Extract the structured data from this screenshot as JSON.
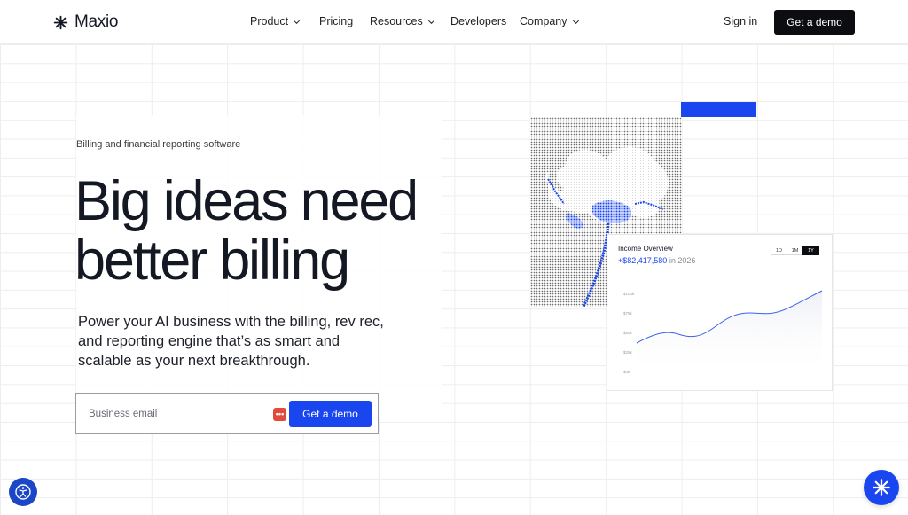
{
  "nav": {
    "logo_text": "Maxio",
    "links": [
      {
        "label": "Product",
        "has_dropdown": true
      },
      {
        "label": "Pricing",
        "has_dropdown": false
      },
      {
        "label": "Resources",
        "has_dropdown": true
      },
      {
        "label": "Developers",
        "has_dropdown": false
      },
      {
        "label": "Company",
        "has_dropdown": true
      }
    ],
    "sign_in": "Sign in",
    "cta": "Get a demo"
  },
  "hero": {
    "eyebrow": "Billing and financial reporting software",
    "headline_line1": "Big ideas need",
    "headline_line2": "better billing",
    "subcopy": "Power your AI business with the billing, rev rec, and reporting engine that’s as smart and scalable as your next breakthrough.",
    "email_placeholder": "Business email",
    "email_value": "",
    "form_cta": "Get a demo",
    "password_manager_badge": "•••"
  },
  "income_card": {
    "title": "Income Overview",
    "value": "+$82,417,580",
    "period_label": "in 2026",
    "tabs": [
      "1D",
      "1M",
      "1Y"
    ],
    "active_tab": "1Y",
    "y_tick_labels": [
      "$100k",
      "$75k",
      "$50k",
      "$25k",
      "$0k"
    ]
  },
  "colors": {
    "brand_blue": "#1a46f0",
    "dark": "#0c0d10",
    "text": "#141823"
  },
  "icons": {
    "logo": "maxio-asterisk-icon",
    "accessibility": "accessibility-icon",
    "chat": "maxio-chat-icon"
  }
}
